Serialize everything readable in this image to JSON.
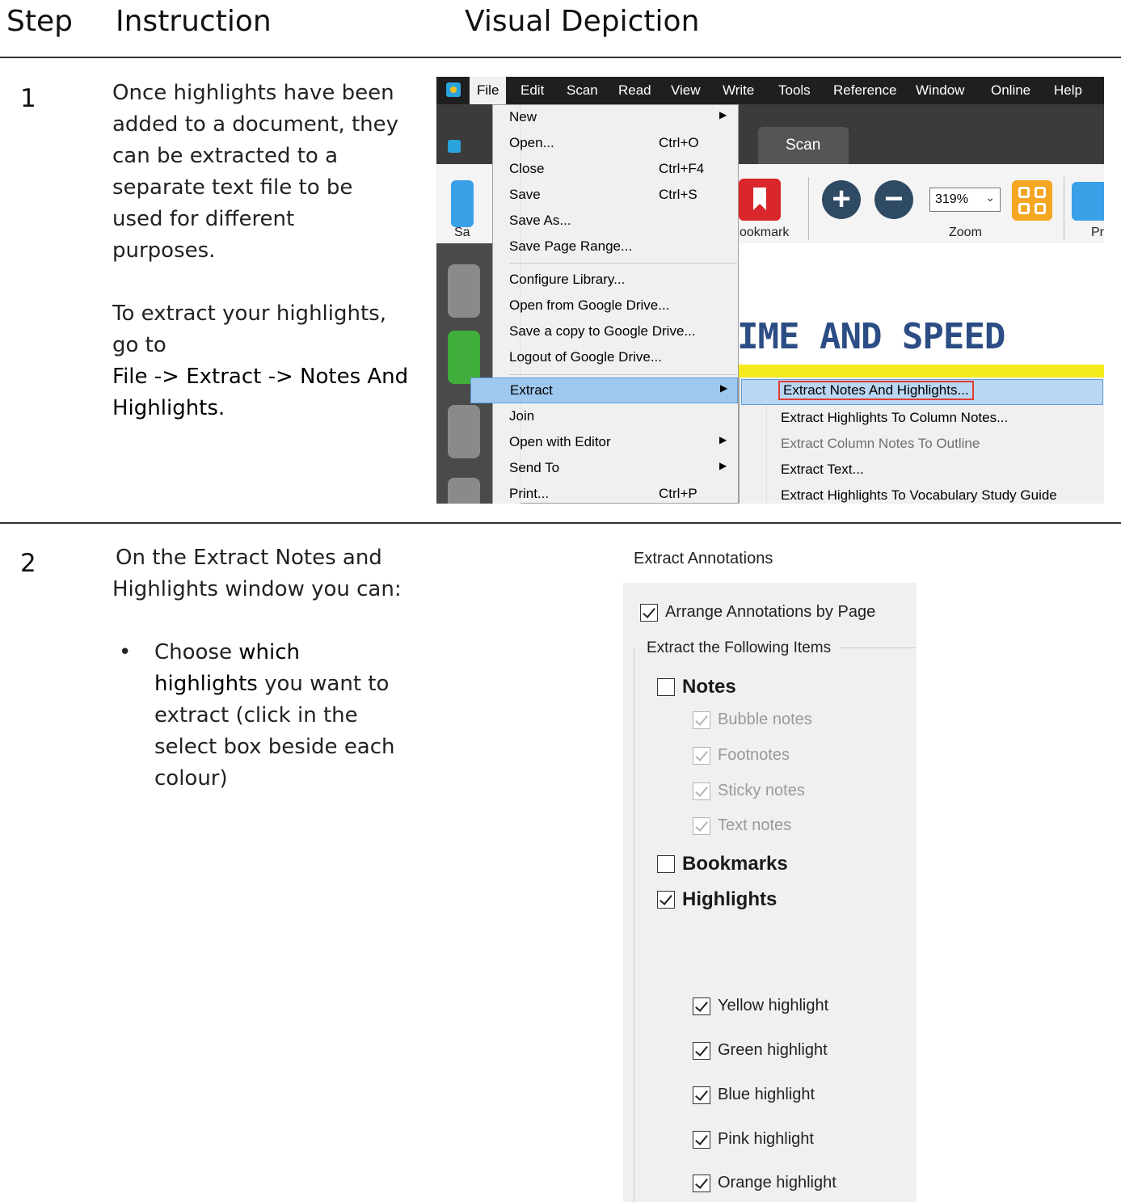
{
  "header": {
    "step": "Step",
    "instruction": "Instruction",
    "visual": "Visual Depiction"
  },
  "step1": {
    "number": "1",
    "lines": [
      "Once highlights have been",
      "added to a document, they",
      "can be extracted to a",
      "separate text file to be",
      "used for different",
      "purposes."
    ],
    "lines2": [
      "To extract your highlights,",
      "go to"
    ],
    "path_lines": [
      "File -> Extract -> Notes And",
      "Highlights."
    ]
  },
  "step2": {
    "number": "2",
    "lines": [
      "On the Extract Notes and",
      "Highlights window you can:"
    ],
    "bullet_pre": "Choose ",
    "bullet_em1": "which",
    "bullet_em2": "highlights",
    "bullet_post": " you want to",
    "bullet_lines": [
      "extract (click in the",
      "select box beside each",
      "colour)"
    ]
  },
  "screen1": {
    "menubar": [
      "File",
      "Edit",
      "Scan",
      "Read",
      "View",
      "Write",
      "Tools",
      "Reference",
      "Window",
      "Online",
      "Help"
    ],
    "tab_scan": "Scan",
    "ribbon_labels": {
      "save_partial": "Sa",
      "bookmark_partial": "ookmark",
      "zoom": "Zoom",
      "print_partial": "Pr"
    },
    "zoom_value": "319%",
    "doc_title": "IME AND SPEED",
    "file_menu": [
      {
        "label": "New",
        "shortcut": "",
        "arrow": true
      },
      {
        "label": "Open...",
        "shortcut": "Ctrl+O",
        "arrow": false
      },
      {
        "label": "Close",
        "shortcut": "Ctrl+F4",
        "arrow": false
      },
      {
        "label": "Save",
        "shortcut": "Ctrl+S",
        "arrow": false
      },
      {
        "label": "Save As...",
        "shortcut": "",
        "arrow": false
      },
      {
        "label": "Save Page Range...",
        "shortcut": "",
        "arrow": false
      },
      {
        "label": "Configure Library...",
        "shortcut": "",
        "arrow": false
      },
      {
        "label": "Open from Google Drive...",
        "shortcut": "",
        "arrow": false
      },
      {
        "label": "Save a copy to Google Drive...",
        "shortcut": "",
        "arrow": false
      },
      {
        "label": "Logout of Google Drive...",
        "shortcut": "",
        "arrow": false
      },
      {
        "label": "Extract",
        "shortcut": "",
        "arrow": true
      },
      {
        "label": "Join",
        "shortcut": "",
        "arrow": false
      },
      {
        "label": "Open with Editor",
        "shortcut": "",
        "arrow": true
      },
      {
        "label": "Send To",
        "shortcut": "",
        "arrow": true
      },
      {
        "label": "Print...",
        "shortcut": "Ctrl+P",
        "arrow": false
      }
    ],
    "extract_submenu": [
      "Extract Notes And Highlights...",
      "Extract Highlights To Column Notes...",
      "Extract Column Notes To Outline",
      "Extract Text...",
      "Extract Highlights To Vocabulary Study Guide"
    ]
  },
  "screen2": {
    "title": "Extract Annotations",
    "arrange": "Arrange Annotations by Page",
    "group_label": "Extract the Following Items",
    "notes": "Notes",
    "note_types": [
      "Bubble notes",
      "Footnotes",
      "Sticky notes",
      "Text notes"
    ],
    "bookmarks": "Bookmarks",
    "highlights": "Highlights",
    "highlight_colors": [
      "Yellow highlight",
      "Green highlight",
      "Blue highlight",
      "Pink highlight",
      "Orange highlight"
    ]
  }
}
